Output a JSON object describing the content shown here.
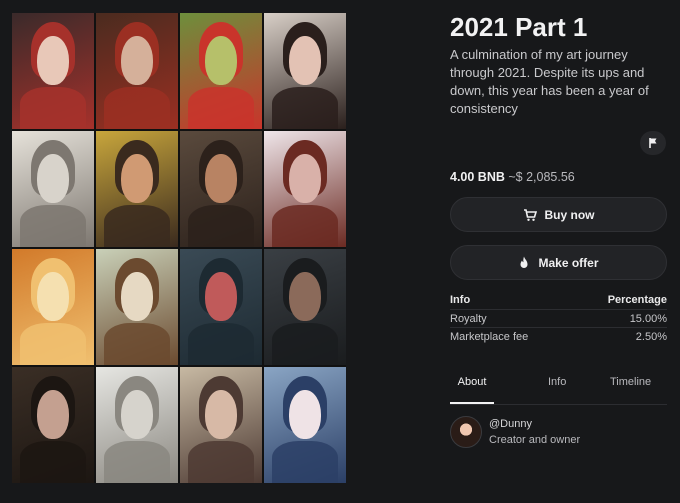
{
  "nft": {
    "title": "2021 Part 1",
    "description": "A culmination of my art journey through 2021. Despite its ups and down, this year has been a year of consistency",
    "price_bnb": "4.00 BNB",
    "price_usd": "~$ 2,085.56"
  },
  "actions": {
    "buy_label": "Buy now",
    "offer_label": "Make offer",
    "flag_icon": "flag-icon"
  },
  "info_table": {
    "header_left": "Info",
    "header_right": "Percentage",
    "rows": [
      {
        "label": "Royalty",
        "value": "15.00%"
      },
      {
        "label": "Marketplace fee",
        "value": "2.50%"
      }
    ]
  },
  "tabs": [
    {
      "label": "About",
      "active": true
    },
    {
      "label": "Info",
      "active": false
    },
    {
      "label": "Timeline",
      "active": false
    }
  ],
  "creator": {
    "handle": "@Dunny",
    "role": "Creator and owner"
  },
  "artwork": {
    "grid": "4x4 collage of portrait illustrations",
    "tile_palettes": [
      [
        "#3a2a2a",
        "#a6312b",
        "#e8c8b8"
      ],
      [
        "#4a2b1f",
        "#9b2f22",
        "#d5b09a"
      ],
      [
        "#6d8f3c",
        "#c9342b",
        "#b6c06a"
      ],
      [
        "#d8cfc7",
        "#2a1f1c",
        "#e3c2b4"
      ],
      [
        "#e6e2da",
        "#7d7770",
        "#d8d3cb"
      ],
      [
        "#c8a63c",
        "#3a2a1e",
        "#d09a73"
      ],
      [
        "#5a4a3d",
        "#2c211b",
        "#b88363"
      ],
      [
        "#efe6ea",
        "#6b2a22",
        "#d9b1a9"
      ],
      [
        "#d27a2a",
        "#f0c070",
        "#f5e0b0"
      ],
      [
        "#c9d0b8",
        "#6b4a2f",
        "#e6d9c3"
      ],
      [
        "#3a4a55",
        "#1d2a32",
        "#c05a5a"
      ],
      [
        "#3a3f44",
        "#1a1c1e",
        "#8b6a5a"
      ],
      [
        "#3a2e25",
        "#1c1612",
        "#c4a090"
      ],
      [
        "#e6e6e2",
        "#8a8780",
        "#d6d3cc"
      ],
      [
        "#c7b9a3",
        "#4d3a33",
        "#d7b9a6"
      ],
      [
        "#8aa5c4",
        "#2b3f66",
        "#efe3e6"
      ]
    ]
  }
}
